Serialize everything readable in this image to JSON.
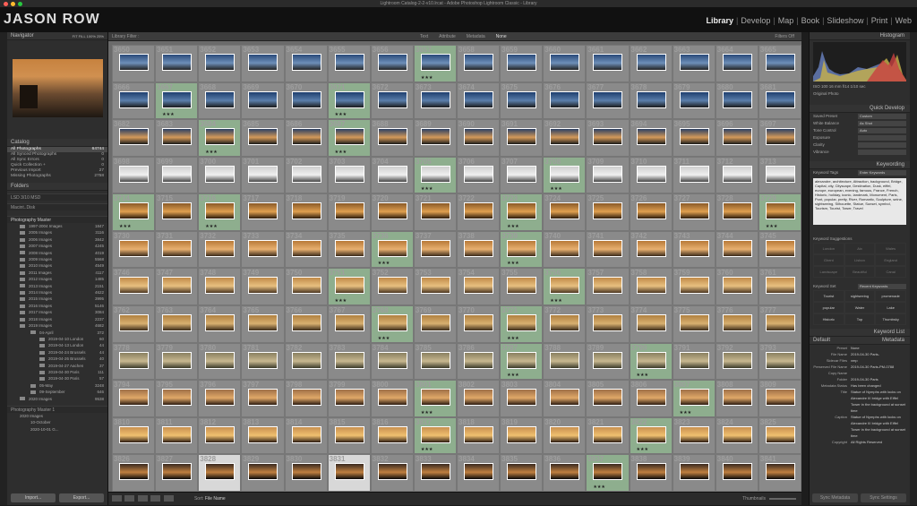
{
  "window": {
    "title": "Lightroom Catalog-2-2-v10.lrcat - Adobe Photoshop Lightroom Classic - Library"
  },
  "brand": {
    "logo": "JASON ROW"
  },
  "modules": [
    "Library",
    "Develop",
    "Map",
    "Book",
    "Slideshow",
    "Print",
    "Web"
  ],
  "left_panel": {
    "navigator_title": "Navigator",
    "navigator_zoom": "FIT  FILL  100%  25%",
    "catalog_title": "Catalog",
    "catalog_items": [
      {
        "label": "All Photographs",
        "count": "64744"
      },
      {
        "label": "All Synced Photographs",
        "count": "0"
      },
      {
        "label": "All Sync Errors",
        "count": "0"
      },
      {
        "label": "Quick Collection +",
        "count": "0"
      },
      {
        "label": "Previous Import",
        "count": "27"
      },
      {
        "label": "Missing Photographs",
        "count": "2758"
      }
    ],
    "folders_title": "Folders",
    "volumes": [
      "LSD 3/10 MSD",
      "Macint..Disk"
    ],
    "master_folder": "Photography Master",
    "folders": [
      {
        "label": "1997-2004 Images",
        "count": "1847"
      },
      {
        "label": "2005 Images",
        "count": "3116"
      },
      {
        "label": "2006 Images",
        "count": "3842"
      },
      {
        "label": "2007 Images",
        "count": "4245"
      },
      {
        "label": "2008 Images",
        "count": "4019"
      },
      {
        "label": "2009 Images",
        "count": "5568"
      },
      {
        "label": "2010 Images",
        "count": "4549"
      },
      {
        "label": "2011 Images",
        "count": "4117"
      },
      {
        "label": "2012 Images",
        "count": "1485"
      },
      {
        "label": "2013 Images",
        "count": "2151"
      },
      {
        "label": "2014 Images",
        "count": "4622"
      },
      {
        "label": "2015 Images",
        "count": "3995"
      },
      {
        "label": "2016 Images",
        "count": "5146"
      },
      {
        "label": "2017 Images",
        "count": "3084"
      },
      {
        "label": "2018 Images",
        "count": "2237"
      },
      {
        "label": "2019 Images",
        "count": "4682"
      }
    ],
    "subfolders": [
      {
        "label": "04-April",
        "count": "372",
        "level": 1
      },
      {
        "label": "2019-04-10 London",
        "count": "60",
        "level": 2
      },
      {
        "label": "2019-04-13 London",
        "count": "44",
        "level": 2
      },
      {
        "label": "2019-04-24 Brussels",
        "count": "44",
        "level": 2
      },
      {
        "label": "2019-04-26 Brussels",
        "count": "40",
        "level": 2
      },
      {
        "label": "2019-04-27 Aachen",
        "count": "37",
        "level": 2
      },
      {
        "label": "2019-04-30 Paris",
        "count": "111",
        "level": 2
      },
      {
        "label": "2019-04-30 Paris",
        "count": "57",
        "level": 2
      },
      {
        "label": "05-May",
        "count": "3248",
        "level": 1
      },
      {
        "label": "09-September",
        "count": "646",
        "level": 1
      },
      {
        "label": "2020 Images",
        "count": "9538",
        "level": 0
      }
    ],
    "master2": "Photography Master 1",
    "master2_items": [
      "2020 Images",
      "10-October",
      "2020-10-01 G..."
    ],
    "import_label": "Import...",
    "export_label": "Export..."
  },
  "filter_bar": {
    "title": "Library Filter :",
    "options": [
      "Text",
      "Attribute",
      "Metadata",
      "None"
    ],
    "preset": "Filters Off"
  },
  "grid": {
    "columns": 16,
    "rows": 12,
    "start_index": 3650,
    "green_cells": [
      7,
      17,
      21,
      34,
      37,
      55,
      58,
      64,
      66,
      73,
      79,
      86,
      89,
      101,
      106,
      118,
      121,
      137,
      140,
      151,
      157,
      167,
      172,
      187,
      194,
      201,
      203,
      214,
      230,
      242
    ],
    "selected_cells": [
      178,
      181
    ]
  },
  "toolbar": {
    "sort_label": "Sort:",
    "sort_value": "File Name",
    "thumbs_label": "Thumbnails"
  },
  "right_panel": {
    "histogram_title": "Histogram",
    "histogram_info": "ISO 100   16 mm   f/14   1/10 sec",
    "original_photo": "Original Photo",
    "quick_develop_title": "Quick Develop",
    "qd_rows": [
      {
        "label": "Saved Preset",
        "value": "Custom"
      },
      {
        "label": "White Balance",
        "value": "As Shot"
      },
      {
        "label": "Tone Control",
        "value": "Auto"
      },
      {
        "label": "Exposure",
        "value": ""
      },
      {
        "label": "Clarity",
        "value": ""
      },
      {
        "label": "Vibrance",
        "value": ""
      }
    ],
    "keywording_title": "Keywording",
    "keyword_tags": "Enter Keywords",
    "keywords": "alexandre, architecture, Attraction, background, Bridge, Capital, city, Cityscape, Destination, Dusk, eiffel, europe, european, evening, famous, France, French, Historic, holiday, iconic, landmark, Monument, Paris, Pont, popular, pretty, River, Romantic, Sculpture, seine, sightseeing, Silhouette, Statue, Sunset, symbol, Tourism, Tourist, Tower, Travel",
    "suggestions_title": "Keyword Suggestions",
    "suggestions": [
      "London",
      "Aix",
      "Wales",
      "Ghent",
      "Lisbon",
      "England",
      "Landscape",
      "Beautiful",
      "Canal"
    ],
    "keyword_set_label": "Keyword Set",
    "keyword_set_value": "Recent Keywords",
    "keyword_set": [
      "Tourist",
      "sightseeing",
      "promenade",
      "popular",
      "Water",
      "Lake",
      "Historic",
      "Top",
      "Thumbsky"
    ],
    "keyword_list_title": "Keyword List",
    "metadata_title": "Metadata",
    "metadata_preset": "Default",
    "metadata": [
      {
        "k": "Preset",
        "v": "None"
      },
      {
        "k": "File Name",
        "v": "2019-04-30 Paris-"
      },
      {
        "k": "Sidecar Files",
        "v": "xmp"
      },
      {
        "k": "Preserved File Name",
        "v": "2019-04-30 Paris-PM-0788"
      },
      {
        "k": "Copy Name",
        "v": ""
      },
      {
        "k": "Folder",
        "v": "2019-04-30 Paris"
      },
      {
        "k": "Metadata Status",
        "v": "Has been changed"
      },
      {
        "k": "Title",
        "v": "Statue of Nymphs with locks on Alexandre III bridge with Eiffel Tower in the background at sunset time"
      },
      {
        "k": "Caption",
        "v": "Statue of Nymphs with locks on Alexandre III bridge with Eiffel Tower in the background at sunset time"
      },
      {
        "k": "Copyright",
        "v": "All Rights Reserved"
      }
    ],
    "sync_metadata": "Sync Metadata",
    "sync_settings": "Sync Settings"
  }
}
